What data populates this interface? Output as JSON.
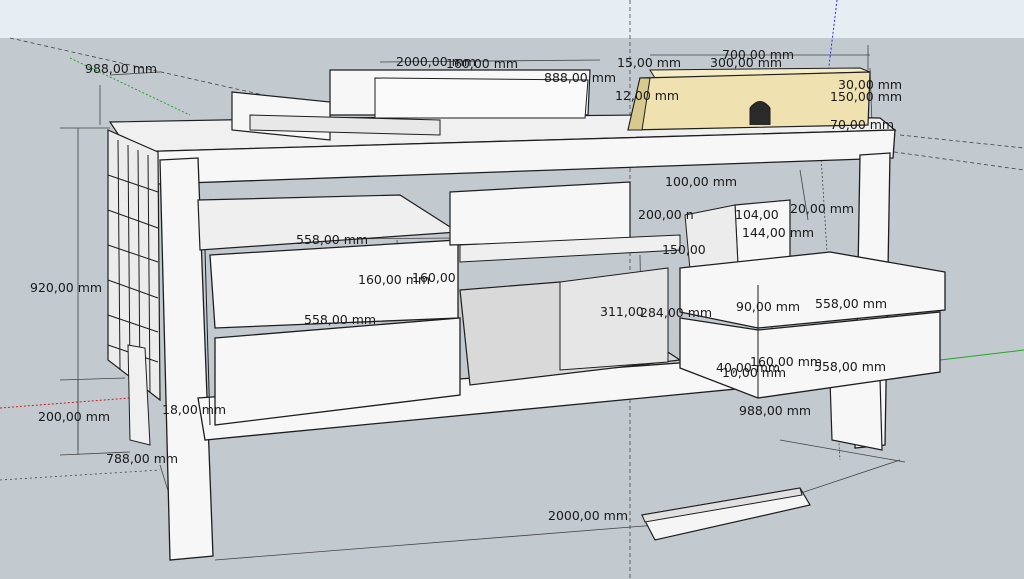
{
  "colors": {
    "sky": "#e6eef4",
    "ground": "#c2c9cf",
    "panel": "#f7f7f7",
    "edge": "#1e1e1e",
    "wood": "#efe2b0",
    "dim_text": "#1a1a1a"
  },
  "dimensions": [
    "988,00 mm",
    "2000,00 mm",
    "160,00 mm",
    "15,00 mm",
    "700,00 mm",
    "888,00 mm",
    "300,00 mm",
    "12,00 mm",
    "30,00 mm",
    "150,00 mm",
    "70,00 mm",
    "920,00 mm",
    "558,00 mm",
    "160,00 mm",
    "160,00",
    "558,00 mm",
    "200,00 mm",
    "788,00 mm",
    "18,00 mm",
    "100,00 mm",
    "200,00 n",
    "104,00",
    "20,00 mm",
    "144,00 mm",
    "150,00",
    "311,00",
    "284,00 mm",
    "90,00 mm",
    "558,00 mm",
    "160,00 mm",
    "40,00 mm",
    "10,00 mm",
    "558,00 mm",
    "988,00 mm",
    "2000,00 mm"
  ]
}
